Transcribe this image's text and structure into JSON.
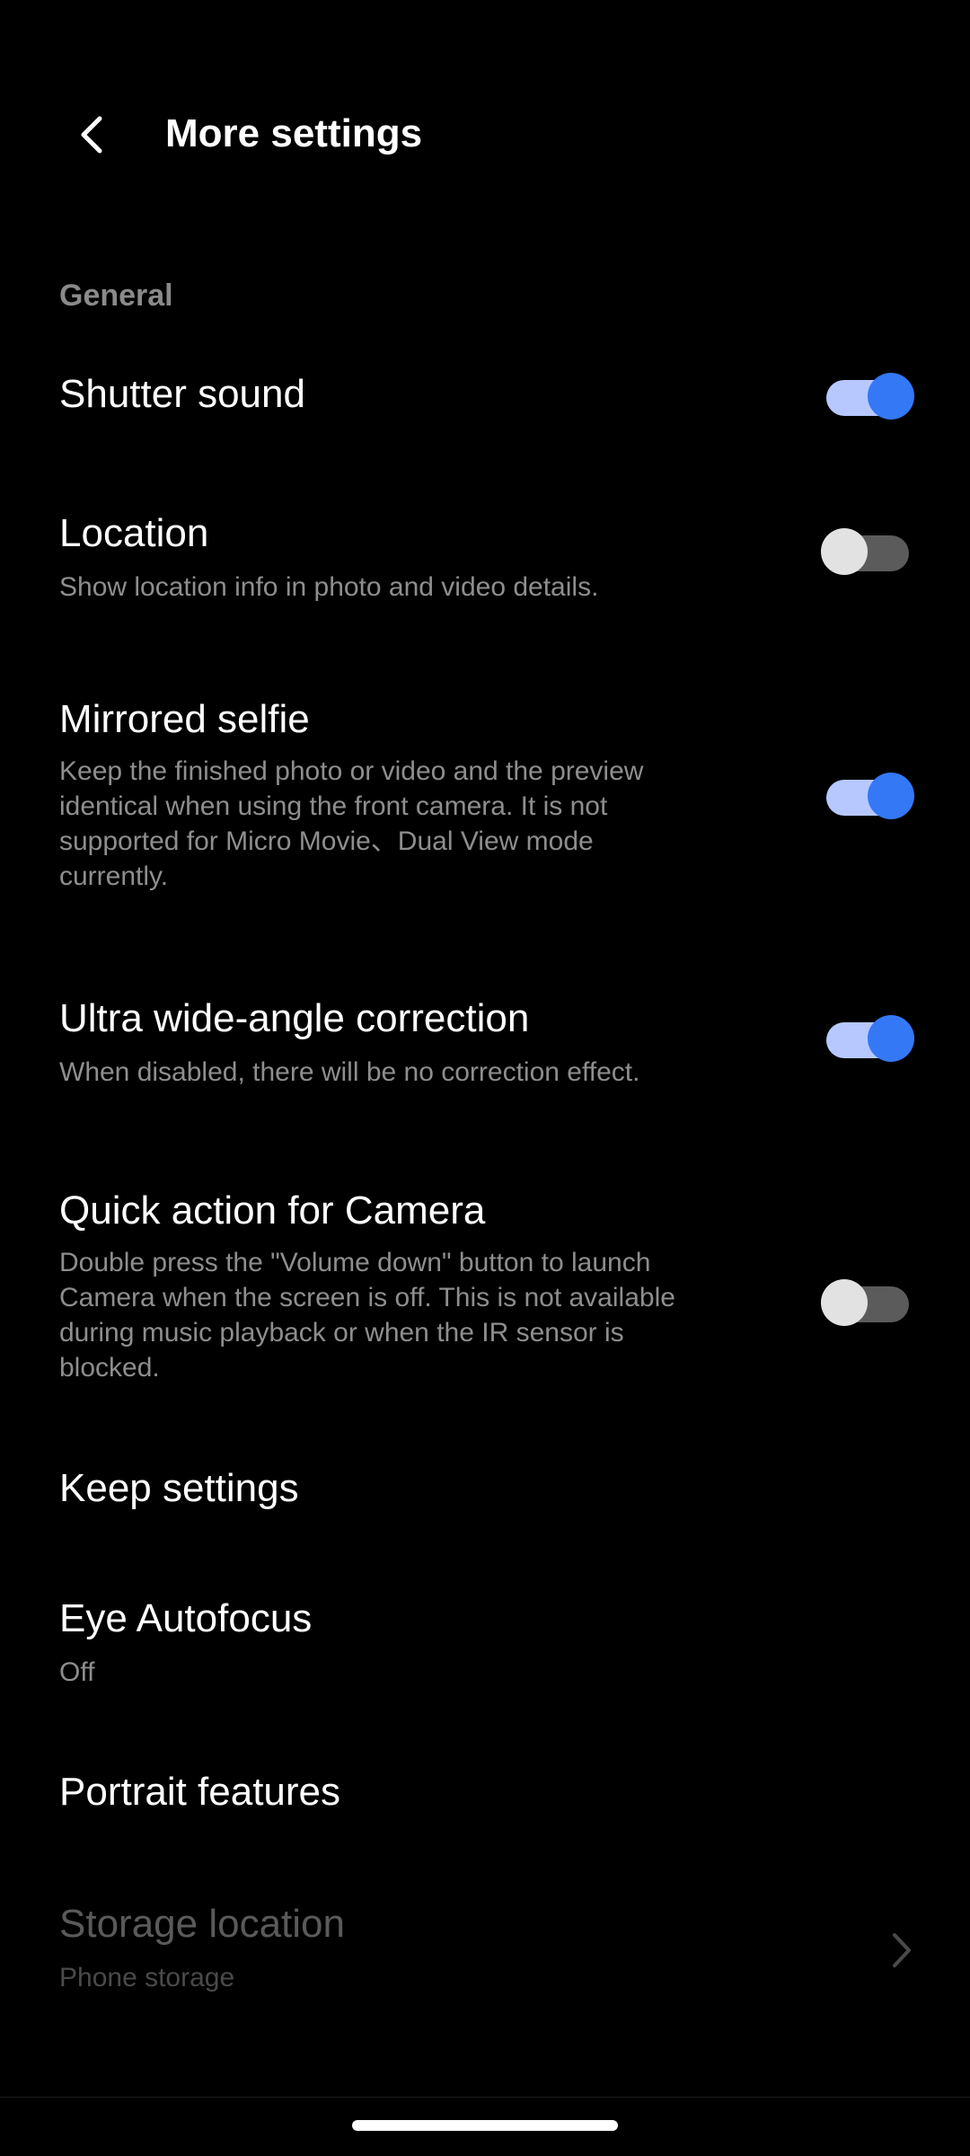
{
  "header": {
    "title": "More settings",
    "back_icon": "chevron-left-icon"
  },
  "section": {
    "label": "General"
  },
  "items": {
    "shutter_sound": {
      "title": "Shutter sound",
      "toggle": "on"
    },
    "location": {
      "title": "Location",
      "desc": "Show location info in photo and video details.",
      "toggle": "off"
    },
    "mirrored_selfie": {
      "title": "Mirrored selfie",
      "desc_lines": [
        "Keep the finished photo or video and the preview",
        "identical when using the front camera. It is not",
        "supported for Micro Movie、Dual View mode",
        "currently."
      ],
      "toggle": "on"
    },
    "ultra_wide": {
      "title": "Ultra wide-angle correction",
      "desc": "When disabled, there will be no correction effect.",
      "toggle": "on"
    },
    "quick_action": {
      "title": "Quick action for Camera",
      "desc_lines": [
        "Double press the \"Volume down\" button to launch",
        "Camera when the screen is off. This is not available",
        "during music playback or when the IR sensor is",
        "blocked."
      ],
      "toggle": "off"
    },
    "keep_settings": {
      "title": "Keep settings"
    },
    "eye_autofocus": {
      "title": "Eye Autofocus",
      "value": "Off"
    },
    "portrait_features": {
      "title": "Portrait features"
    },
    "storage_location": {
      "title": "Storage location",
      "value": "Phone storage",
      "icon": "chevron-right-icon"
    }
  },
  "colors": {
    "accent": "#3478f6",
    "accent_track": "#b6c8ff",
    "background": "#000000",
    "secondary_text": "#8e8e8e",
    "disabled_text": "#5a5a5a"
  }
}
